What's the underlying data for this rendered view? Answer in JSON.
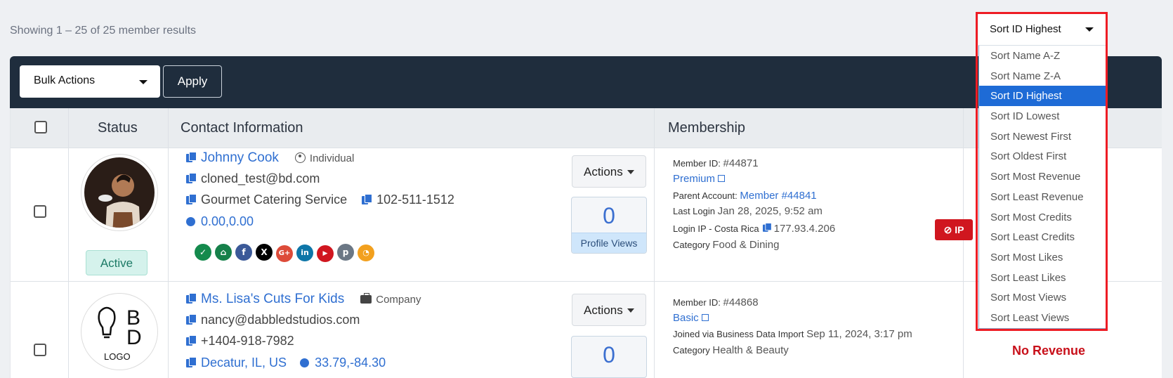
{
  "results_text": "Showing 1 – 25 of 25 member results",
  "toolbar": {
    "bulk_actions_label": "Bulk Actions",
    "apply_label": "Apply"
  },
  "sort": {
    "selected": "Sort ID Highest",
    "options": [
      "Sort Name A-Z",
      "Sort Name Z-A",
      "Sort ID Highest",
      "Sort ID Lowest",
      "Sort Newest First",
      "Sort Oldest First",
      "Sort Most Revenue",
      "Sort Least Revenue",
      "Sort Most Credits",
      "Sort Least Credits",
      "Sort Most Likes",
      "Sort Least Likes",
      "Sort Most Views",
      "Sort Least Views"
    ]
  },
  "table": {
    "headers": {
      "status": "Status",
      "contact": "Contact Information",
      "membership": "Membership"
    }
  },
  "rows": [
    {
      "status": "Active",
      "name": "Johnny Cook",
      "type": "Individual",
      "email": "cloned_test@bd.com",
      "company": "Gourmet Catering Service",
      "phone": "102-511-1512",
      "location": "0.00,0.00",
      "actions_label": "Actions",
      "profile_views": "0",
      "profile_views_label": "Profile Views",
      "member_id_label": "Member ID:",
      "member_id": "#44871",
      "plan": "Premium",
      "parent_account_label": "Parent Account:",
      "parent_account": "Member #44841",
      "last_login_label": "Last Login",
      "last_login": "Jan 28, 2025, 9:52 am",
      "login_ip_label": "Login IP - Costa Rica",
      "login_ip": "177.93.4.206",
      "category_label": "Category",
      "category": "Food & Dining",
      "ip_badge": "IP",
      "socials": [
        "check",
        "home",
        "f",
        "X",
        "G+",
        "in",
        "yt",
        "p",
        "rss"
      ]
    },
    {
      "name": "Ms. Lisa's Cuts For Kids",
      "type": "Company",
      "email": "nancy@dabbledstudios.com",
      "phone": "+1404-918-7982",
      "location_partial": "Decatur, IL, US",
      "coords_partial": "33.79,-84.30",
      "actions_label": "Actions",
      "profile_views": "0",
      "member_id_label": "Member ID:",
      "member_id": "#44868",
      "plan": "Basic",
      "joined_label": "Joined via Business Data Import",
      "joined": "Sep 11, 2024, 3:17 pm",
      "category_label": "Category",
      "category": "Health & Beauty",
      "revenue": "No Revenue",
      "logo_text": "LOGO",
      "logo_letters": "BD"
    }
  ],
  "colors": {
    "navy": "#1f2d3d",
    "link": "#2f6fd1",
    "selected": "#1e6bd6",
    "danger": "#d0161f",
    "highlight": "#ee1c24"
  }
}
